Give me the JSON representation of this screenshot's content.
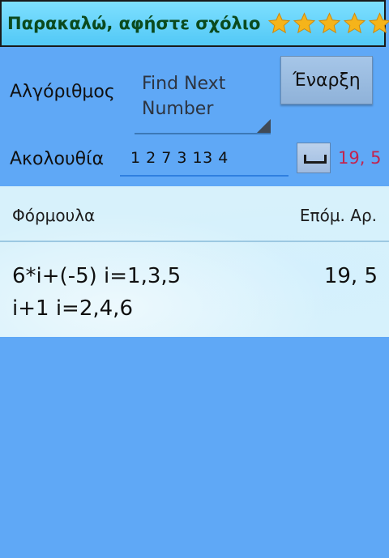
{
  "banner": {
    "text": "Παρακαλώ, αφήστε σχόλιο",
    "stars": 5,
    "star_color": "#f5b41a"
  },
  "algorithm": {
    "label": "Αλγόριθμος",
    "selected": "Find Next Number"
  },
  "start_button": {
    "label": "Έναρξη"
  },
  "sequence": {
    "label": "Ακολουθία",
    "value": "1 2 7 3 13 4",
    "result": "19, 5"
  },
  "table": {
    "headers": {
      "formula": "Φόρμουλα",
      "next": "Επόμ. Αρ."
    },
    "rows": [
      {
        "formula_line1": "6*i+(-5) i=1,3,5",
        "formula_line2": "i+1 i=2,4,6",
        "next": "19, 5"
      }
    ]
  },
  "colors": {
    "background": "#5fa8f6",
    "result_accent": "#c3244f",
    "banner_text": "#0b4a1e"
  }
}
